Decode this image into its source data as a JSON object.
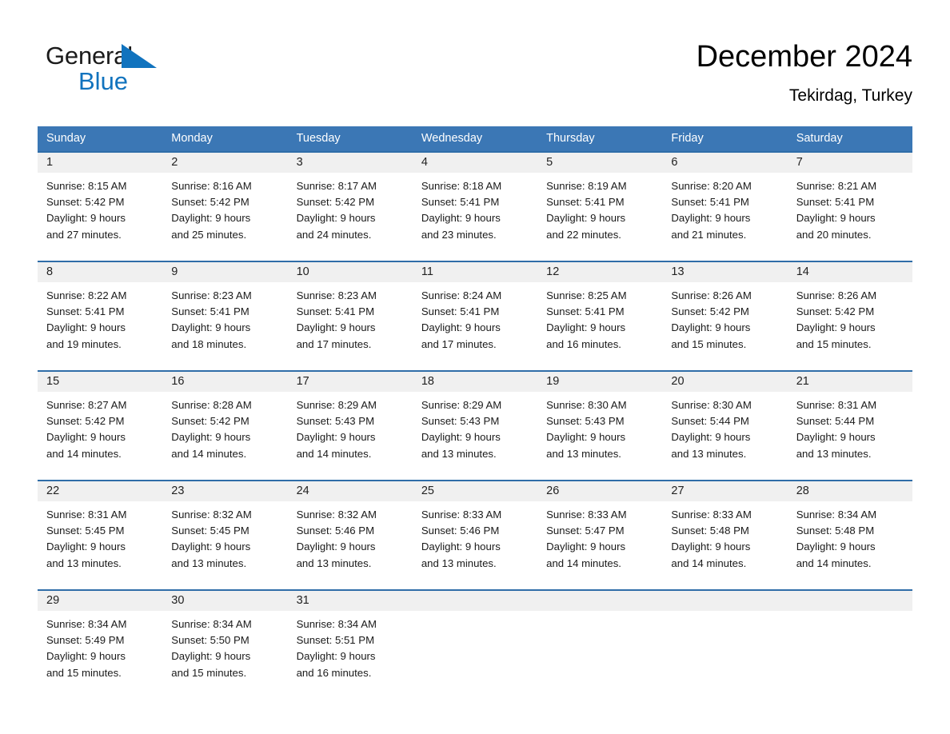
{
  "brand": {
    "word1": "General",
    "word2": "Blue",
    "triangle_icon": "brand-triangle-icon",
    "accent_color": "#1173be"
  },
  "header": {
    "title": "December 2024",
    "subtitle": "Tekirdag, Turkey"
  },
  "theme": {
    "header_row_bg": "#3b77b5",
    "week_divider": "#2f6da8",
    "daynum_band_bg": "#f0f0f0",
    "text": "#1a1a1a"
  },
  "calendar": {
    "day_headers": [
      "Sunday",
      "Monday",
      "Tuesday",
      "Wednesday",
      "Thursday",
      "Friday",
      "Saturday"
    ],
    "weeks": [
      [
        {
          "day": "1",
          "lines": [
            "Sunrise: 8:15 AM",
            "Sunset: 5:42 PM",
            "Daylight: 9 hours",
            "and 27 minutes."
          ]
        },
        {
          "day": "2",
          "lines": [
            "Sunrise: 8:16 AM",
            "Sunset: 5:42 PM",
            "Daylight: 9 hours",
            "and 25 minutes."
          ]
        },
        {
          "day": "3",
          "lines": [
            "Sunrise: 8:17 AM",
            "Sunset: 5:42 PM",
            "Daylight: 9 hours",
            "and 24 minutes."
          ]
        },
        {
          "day": "4",
          "lines": [
            "Sunrise: 8:18 AM",
            "Sunset: 5:41 PM",
            "Daylight: 9 hours",
            "and 23 minutes."
          ]
        },
        {
          "day": "5",
          "lines": [
            "Sunrise: 8:19 AM",
            "Sunset: 5:41 PM",
            "Daylight: 9 hours",
            "and 22 minutes."
          ]
        },
        {
          "day": "6",
          "lines": [
            "Sunrise: 8:20 AM",
            "Sunset: 5:41 PM",
            "Daylight: 9 hours",
            "and 21 minutes."
          ]
        },
        {
          "day": "7",
          "lines": [
            "Sunrise: 8:21 AM",
            "Sunset: 5:41 PM",
            "Daylight: 9 hours",
            "and 20 minutes."
          ]
        }
      ],
      [
        {
          "day": "8",
          "lines": [
            "Sunrise: 8:22 AM",
            "Sunset: 5:41 PM",
            "Daylight: 9 hours",
            "and 19 minutes."
          ]
        },
        {
          "day": "9",
          "lines": [
            "Sunrise: 8:23 AM",
            "Sunset: 5:41 PM",
            "Daylight: 9 hours",
            "and 18 minutes."
          ]
        },
        {
          "day": "10",
          "lines": [
            "Sunrise: 8:23 AM",
            "Sunset: 5:41 PM",
            "Daylight: 9 hours",
            "and 17 minutes."
          ]
        },
        {
          "day": "11",
          "lines": [
            "Sunrise: 8:24 AM",
            "Sunset: 5:41 PM",
            "Daylight: 9 hours",
            "and 17 minutes."
          ]
        },
        {
          "day": "12",
          "lines": [
            "Sunrise: 8:25 AM",
            "Sunset: 5:41 PM",
            "Daylight: 9 hours",
            "and 16 minutes."
          ]
        },
        {
          "day": "13",
          "lines": [
            "Sunrise: 8:26 AM",
            "Sunset: 5:42 PM",
            "Daylight: 9 hours",
            "and 15 minutes."
          ]
        },
        {
          "day": "14",
          "lines": [
            "Sunrise: 8:26 AM",
            "Sunset: 5:42 PM",
            "Daylight: 9 hours",
            "and 15 minutes."
          ]
        }
      ],
      [
        {
          "day": "15",
          "lines": [
            "Sunrise: 8:27 AM",
            "Sunset: 5:42 PM",
            "Daylight: 9 hours",
            "and 14 minutes."
          ]
        },
        {
          "day": "16",
          "lines": [
            "Sunrise: 8:28 AM",
            "Sunset: 5:42 PM",
            "Daylight: 9 hours",
            "and 14 minutes."
          ]
        },
        {
          "day": "17",
          "lines": [
            "Sunrise: 8:29 AM",
            "Sunset: 5:43 PM",
            "Daylight: 9 hours",
            "and 14 minutes."
          ]
        },
        {
          "day": "18",
          "lines": [
            "Sunrise: 8:29 AM",
            "Sunset: 5:43 PM",
            "Daylight: 9 hours",
            "and 13 minutes."
          ]
        },
        {
          "day": "19",
          "lines": [
            "Sunrise: 8:30 AM",
            "Sunset: 5:43 PM",
            "Daylight: 9 hours",
            "and 13 minutes."
          ]
        },
        {
          "day": "20",
          "lines": [
            "Sunrise: 8:30 AM",
            "Sunset: 5:44 PM",
            "Daylight: 9 hours",
            "and 13 minutes."
          ]
        },
        {
          "day": "21",
          "lines": [
            "Sunrise: 8:31 AM",
            "Sunset: 5:44 PM",
            "Daylight: 9 hours",
            "and 13 minutes."
          ]
        }
      ],
      [
        {
          "day": "22",
          "lines": [
            "Sunrise: 8:31 AM",
            "Sunset: 5:45 PM",
            "Daylight: 9 hours",
            "and 13 minutes."
          ]
        },
        {
          "day": "23",
          "lines": [
            "Sunrise: 8:32 AM",
            "Sunset: 5:45 PM",
            "Daylight: 9 hours",
            "and 13 minutes."
          ]
        },
        {
          "day": "24",
          "lines": [
            "Sunrise: 8:32 AM",
            "Sunset: 5:46 PM",
            "Daylight: 9 hours",
            "and 13 minutes."
          ]
        },
        {
          "day": "25",
          "lines": [
            "Sunrise: 8:33 AM",
            "Sunset: 5:46 PM",
            "Daylight: 9 hours",
            "and 13 minutes."
          ]
        },
        {
          "day": "26",
          "lines": [
            "Sunrise: 8:33 AM",
            "Sunset: 5:47 PM",
            "Daylight: 9 hours",
            "and 14 minutes."
          ]
        },
        {
          "day": "27",
          "lines": [
            "Sunrise: 8:33 AM",
            "Sunset: 5:48 PM",
            "Daylight: 9 hours",
            "and 14 minutes."
          ]
        },
        {
          "day": "28",
          "lines": [
            "Sunrise: 8:34 AM",
            "Sunset: 5:48 PM",
            "Daylight: 9 hours",
            "and 14 minutes."
          ]
        }
      ],
      [
        {
          "day": "29",
          "lines": [
            "Sunrise: 8:34 AM",
            "Sunset: 5:49 PM",
            "Daylight: 9 hours",
            "and 15 minutes."
          ]
        },
        {
          "day": "30",
          "lines": [
            "Sunrise: 8:34 AM",
            "Sunset: 5:50 PM",
            "Daylight: 9 hours",
            "and 15 minutes."
          ]
        },
        {
          "day": "31",
          "lines": [
            "Sunrise: 8:34 AM",
            "Sunset: 5:51 PM",
            "Daylight: 9 hours",
            "and 16 minutes."
          ]
        },
        {
          "day": "",
          "lines": []
        },
        {
          "day": "",
          "lines": []
        },
        {
          "day": "",
          "lines": []
        },
        {
          "day": "",
          "lines": []
        }
      ]
    ]
  }
}
